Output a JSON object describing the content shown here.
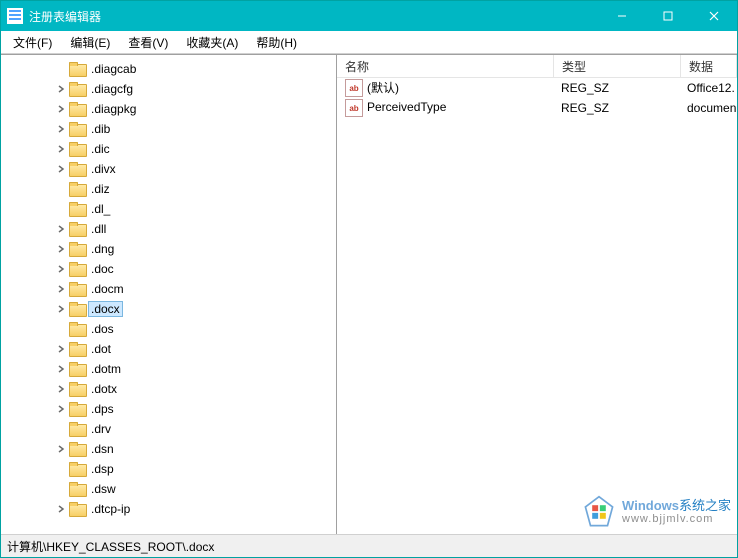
{
  "window": {
    "title": "注册表编辑器"
  },
  "menu": {
    "file": "文件(F)",
    "edit": "编辑(E)",
    "view": "查看(V)",
    "favorites": "收藏夹(A)",
    "help": "帮助(H)"
  },
  "tree": {
    "items": [
      {
        "label": ".diagcab",
        "expander": "none"
      },
      {
        "label": ".diagcfg",
        "expander": "closed"
      },
      {
        "label": ".diagpkg",
        "expander": "closed"
      },
      {
        "label": ".dib",
        "expander": "closed"
      },
      {
        "label": ".dic",
        "expander": "closed"
      },
      {
        "label": ".divx",
        "expander": "closed"
      },
      {
        "label": ".diz",
        "expander": "none"
      },
      {
        "label": ".dl_",
        "expander": "none"
      },
      {
        "label": ".dll",
        "expander": "closed"
      },
      {
        "label": ".dng",
        "expander": "closed"
      },
      {
        "label": ".doc",
        "expander": "closed"
      },
      {
        "label": ".docm",
        "expander": "closed"
      },
      {
        "label": ".docx",
        "expander": "closed",
        "selected": true
      },
      {
        "label": ".dos",
        "expander": "none"
      },
      {
        "label": ".dot",
        "expander": "closed"
      },
      {
        "label": ".dotm",
        "expander": "closed"
      },
      {
        "label": ".dotx",
        "expander": "closed"
      },
      {
        "label": ".dps",
        "expander": "closed"
      },
      {
        "label": ".drv",
        "expander": "none"
      },
      {
        "label": ".dsn",
        "expander": "closed"
      },
      {
        "label": ".dsp",
        "expander": "none"
      },
      {
        "label": ".dsw",
        "expander": "none"
      },
      {
        "label": ".dtcp-ip",
        "expander": "closed"
      }
    ]
  },
  "list": {
    "headers": {
      "name": "名称",
      "type": "类型",
      "data": "数据"
    },
    "rows": [
      {
        "name": "(默认)",
        "type": "REG_SZ",
        "data": "Office12."
      },
      {
        "name": "PerceivedType",
        "type": "REG_SZ",
        "data": "documen"
      }
    ]
  },
  "statusbar": {
    "path": "计算机\\HKEY_CLASSES_ROOT\\.docx"
  },
  "watermark": {
    "line1_a": "Windows",
    "line1_b": "系统之家",
    "line2": "www.bjjmlv.com"
  }
}
